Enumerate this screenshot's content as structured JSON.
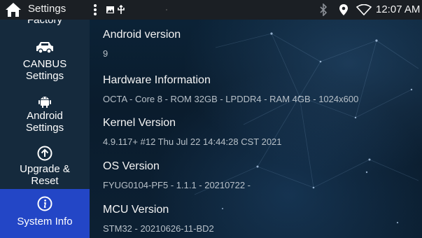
{
  "status_bar": {
    "title": "Settings",
    "time": "12:07 AM",
    "icons": [
      "home-icon",
      "more-vertical-icon",
      "gallery-notification-icon",
      "usb-icon",
      "bluetooth-icon",
      "location-icon",
      "wifi-icon"
    ]
  },
  "sidebar": {
    "items": [
      {
        "label": "Factory",
        "icon": "factory"
      },
      {
        "label": "CANBUS Settings",
        "line1": "CANBUS",
        "line2": "Settings",
        "icon": "car-icon"
      },
      {
        "label": "Android Settings",
        "line1": "Android",
        "line2": "Settings",
        "icon": "android-icon"
      },
      {
        "label": "Upgrade & Reset",
        "line1": "Upgrade &",
        "line2": "Reset",
        "icon": "upgrade-arrow-icon"
      },
      {
        "label": "System Info",
        "icon": "info-icon"
      }
    ],
    "active_color": "#2346c6"
  },
  "info": {
    "android_version_label": "Android version",
    "android_version_value": "9",
    "hardware_label": "Hardware Information",
    "hardware_value": "OCTA - Core 8 - ROM 32GB - LPDDR4 - RAM 4GB - 1024x600",
    "kernel_label": "Kernel Version",
    "kernel_value": "4.9.117+ #12 Thu Jul 22 14:44:28 CST 2021",
    "os_label": "OS Version",
    "os_value": "FYUG0104-PF5 - 1.1.1 - 20210722 -",
    "mcu_label": "MCU Version",
    "mcu_value": "STM32 - 20210626-11-BD2"
  }
}
